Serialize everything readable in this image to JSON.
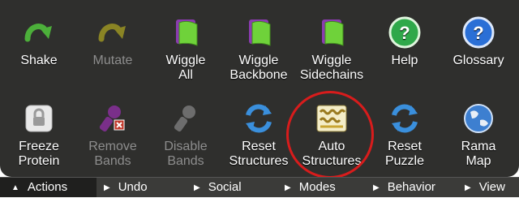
{
  "row1": [
    {
      "id": "shake",
      "label": "Shake",
      "icon": "green-arrow-icon",
      "enabled": true
    },
    {
      "id": "mutate",
      "label": "Mutate",
      "icon": "olive-arrow-icon",
      "enabled": false
    },
    {
      "id": "wiggle-all",
      "label": "Wiggle\nAll",
      "icon": "green-flag-icon",
      "enabled": true
    },
    {
      "id": "wiggle-backbone",
      "label": "Wiggle\nBackbone",
      "icon": "green-flag-icon",
      "enabled": true
    },
    {
      "id": "wiggle-sidechains",
      "label": "Wiggle\nSidechains",
      "icon": "green-flag-icon",
      "enabled": true
    },
    {
      "id": "help",
      "label": "Help",
      "icon": "green-question-icon",
      "enabled": true
    },
    {
      "id": "glossary",
      "label": "Glossary",
      "icon": "blue-question-icon",
      "enabled": true
    }
  ],
  "row2": [
    {
      "id": "freeze-protein",
      "label": "Freeze\nProtein",
      "icon": "lock-icon",
      "enabled": true
    },
    {
      "id": "remove-bands",
      "label": "Remove\nBands",
      "icon": "remove-band-icon",
      "enabled": false
    },
    {
      "id": "disable-bands",
      "label": "Disable\nBands",
      "icon": "disable-band-icon",
      "enabled": false
    },
    {
      "id": "reset-structures",
      "label": "Reset\nStructures",
      "icon": "reset-icon",
      "enabled": true
    },
    {
      "id": "auto-structures",
      "label": "Auto\nStructures",
      "icon": "auto-structures-icon",
      "enabled": true
    },
    {
      "id": "reset-puzzle",
      "label": "Reset\nPuzzle",
      "icon": "reset-icon",
      "enabled": true
    },
    {
      "id": "rama-map",
      "label": "Rama\nMap",
      "icon": "globe-icon",
      "enabled": true
    }
  ],
  "tabs": [
    {
      "label": "Actions",
      "active": true,
      "arrow": "▲"
    },
    {
      "label": "Undo",
      "active": false,
      "arrow": "▶"
    },
    {
      "label": "Social",
      "active": false,
      "arrow": "▶"
    },
    {
      "label": "Modes",
      "active": false,
      "arrow": "▶"
    },
    {
      "label": "Behavior",
      "active": false,
      "arrow": "▶"
    },
    {
      "label": "View",
      "active": false,
      "arrow": "▶"
    }
  ],
  "colors": {
    "panel": "#2f2f2d",
    "highlight": "#d81c1c",
    "disabled_text": "#8d8d8d"
  }
}
